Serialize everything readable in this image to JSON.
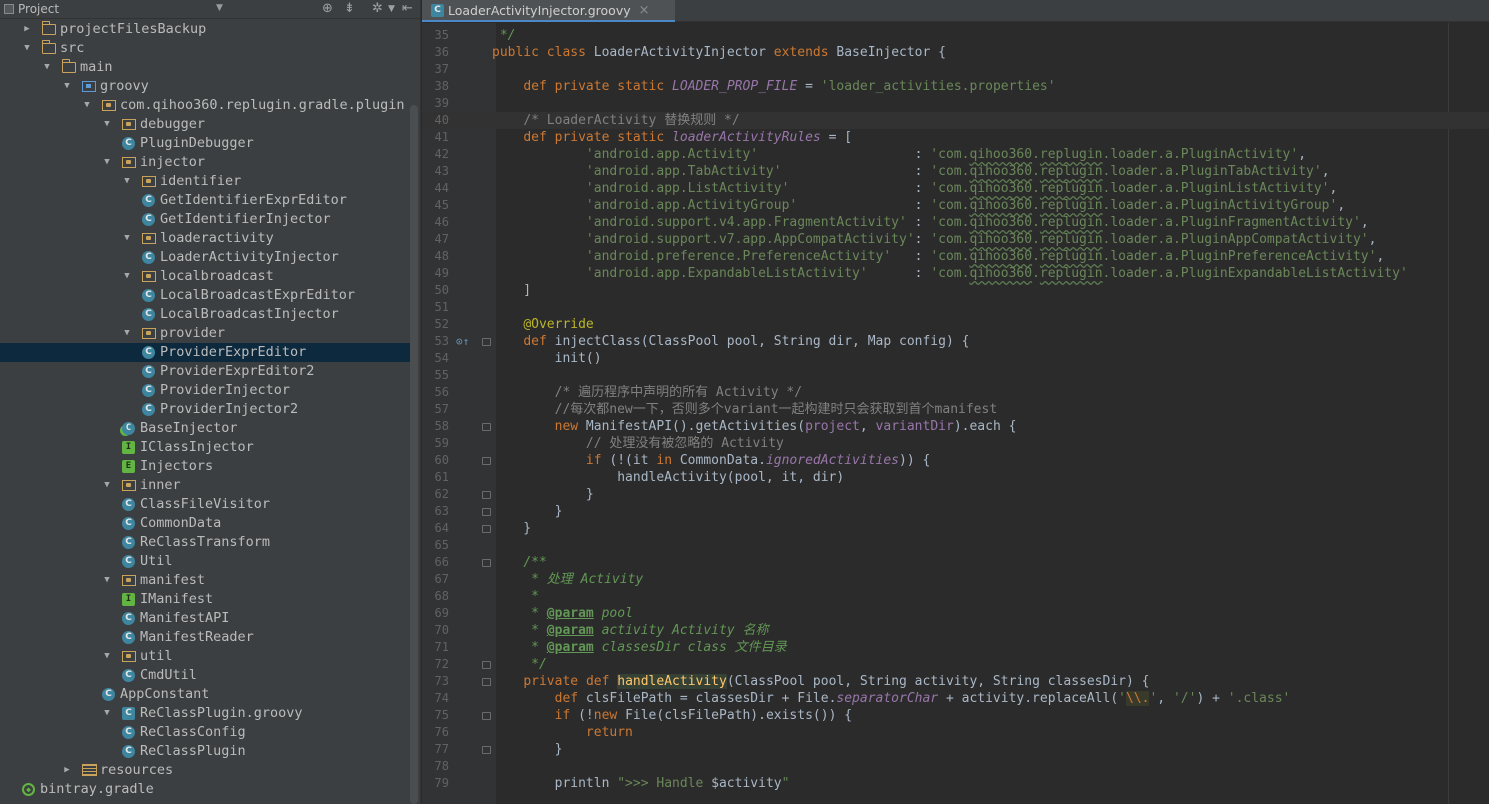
{
  "project_panel": {
    "title": "Project",
    "tree": [
      {
        "label": "projectFilesBackup",
        "icon": "folder-icon",
        "arrow": "▶",
        "depth": 0
      },
      {
        "label": "src",
        "icon": "folder-icon",
        "arrow": "▼",
        "depth": 0
      },
      {
        "label": "main",
        "icon": "folder-icon",
        "arrow": "▼",
        "depth": 1
      },
      {
        "label": "groovy",
        "icon": "source-folder-icon",
        "arrow": "▼",
        "depth": 2
      },
      {
        "label": "com.qihoo360.replugin.gradle.plugin",
        "icon": "package-icon",
        "arrow": "▼",
        "depth": 3
      },
      {
        "label": "debugger",
        "icon": "package-icon",
        "arrow": "▼",
        "depth": 4
      },
      {
        "label": "PluginDebugger",
        "icon": "class-icon",
        "arrow": "",
        "depth": 5
      },
      {
        "label": "injector",
        "icon": "package-icon",
        "arrow": "▼",
        "depth": 4
      },
      {
        "label": "identifier",
        "icon": "package-icon",
        "arrow": "▼",
        "depth": 5
      },
      {
        "label": "GetIdentifierExprEditor",
        "icon": "class-icon",
        "arrow": "",
        "depth": 6
      },
      {
        "label": "GetIdentifierInjector",
        "icon": "class-icon",
        "arrow": "",
        "depth": 6
      },
      {
        "label": "loaderactivity",
        "icon": "package-icon",
        "arrow": "▼",
        "depth": 5
      },
      {
        "label": "LoaderActivityInjector",
        "icon": "class-icon",
        "arrow": "",
        "depth": 6
      },
      {
        "label": "localbroadcast",
        "icon": "package-icon",
        "arrow": "▼",
        "depth": 5
      },
      {
        "label": "LocalBroadcastExprEditor",
        "icon": "class-icon",
        "arrow": "",
        "depth": 6
      },
      {
        "label": "LocalBroadcastInjector",
        "icon": "class-icon",
        "arrow": "",
        "depth": 6
      },
      {
        "label": "provider",
        "icon": "package-icon",
        "arrow": "▼",
        "depth": 5
      },
      {
        "label": "ProviderExprEditor",
        "icon": "class-icon",
        "arrow": "",
        "depth": 6,
        "selected": true
      },
      {
        "label": "ProviderExprEditor2",
        "icon": "class-icon",
        "arrow": "",
        "depth": 6
      },
      {
        "label": "ProviderInjector",
        "icon": "class-icon",
        "arrow": "",
        "depth": 6
      },
      {
        "label": "ProviderInjector2",
        "icon": "class-icon",
        "arrow": "",
        "depth": 6
      },
      {
        "label": "BaseInjector",
        "icon": "abstract-class-icon",
        "arrow": "",
        "depth": 5
      },
      {
        "label": "IClassInjector",
        "icon": "interface-icon",
        "arrow": "",
        "depth": 5
      },
      {
        "label": "Injectors",
        "icon": "enum-icon",
        "arrow": "",
        "depth": 5
      },
      {
        "label": "inner",
        "icon": "package-icon",
        "arrow": "▼",
        "depth": 4
      },
      {
        "label": "ClassFileVisitor",
        "icon": "class-icon",
        "arrow": "",
        "depth": 5
      },
      {
        "label": "CommonData",
        "icon": "class-icon",
        "arrow": "",
        "depth": 5
      },
      {
        "label": "ReClassTransform",
        "icon": "class-icon",
        "arrow": "",
        "depth": 5
      },
      {
        "label": "Util",
        "icon": "class-icon",
        "arrow": "",
        "depth": 5
      },
      {
        "label": "manifest",
        "icon": "package-icon",
        "arrow": "▼",
        "depth": 4
      },
      {
        "label": "IManifest",
        "icon": "interface-icon",
        "arrow": "",
        "depth": 5
      },
      {
        "label": "ManifestAPI",
        "icon": "class-icon",
        "arrow": "",
        "depth": 5
      },
      {
        "label": "ManifestReader",
        "icon": "class-icon",
        "arrow": "",
        "depth": 5
      },
      {
        "label": "util",
        "icon": "package-icon",
        "arrow": "▼",
        "depth": 4
      },
      {
        "label": "CmdUtil",
        "icon": "class-icon",
        "arrow": "",
        "depth": 5
      },
      {
        "label": "AppConstant",
        "icon": "class-icon",
        "arrow": "",
        "depth": 4
      },
      {
        "label": "ReClassPlugin.groovy",
        "icon": "groovy-file-icon",
        "arrow": "▼",
        "depth": 4
      },
      {
        "label": "ReClassConfig",
        "icon": "class-icon",
        "arrow": "",
        "depth": 5
      },
      {
        "label": "ReClassPlugin",
        "icon": "class-icon",
        "arrow": "",
        "depth": 5
      },
      {
        "label": "resources",
        "icon": "resources-folder-icon",
        "arrow": "▶",
        "depth": 2
      },
      {
        "label": "bintray.gradle",
        "icon": "gradle-icon",
        "arrow": "",
        "depth": 0
      }
    ]
  },
  "editor": {
    "tab_label": "LoaderActivityInjector.groovy",
    "tab_close": "×",
    "code_lines": [
      {
        "n": "35",
        "t": [
          [
            " */",
            "d"
          ]
        ]
      },
      {
        "n": "36",
        "t": [
          [
            "public",
            "k"
          ],
          [
            " "
          ],
          [
            "class",
            "k"
          ],
          [
            " LoaderActivityInjector "
          ],
          [
            "extends",
            "k"
          ],
          [
            " BaseInjector {"
          ]
        ]
      },
      {
        "n": "37",
        "t": []
      },
      {
        "n": "38",
        "t": [
          [
            "    "
          ],
          [
            "def",
            "k"
          ],
          [
            " "
          ],
          [
            "private",
            "k"
          ],
          [
            " "
          ],
          [
            "static",
            "k"
          ],
          [
            " "
          ],
          [
            "LOADER_PROP_FILE",
            "f"
          ],
          [
            " = "
          ],
          [
            "'loader_activities.properties'",
            "s"
          ]
        ]
      },
      {
        "n": "39",
        "t": []
      },
      {
        "n": "40",
        "t": [
          [
            "    "
          ],
          [
            "/* LoaderActivity 替换规则 */",
            "c"
          ]
        ],
        "caret": true
      },
      {
        "n": "41",
        "t": [
          [
            "    "
          ],
          [
            "def",
            "k"
          ],
          [
            " "
          ],
          [
            "private",
            "k"
          ],
          [
            " "
          ],
          [
            "static",
            "k"
          ],
          [
            " "
          ],
          [
            "loaderActivityRules",
            "f"
          ],
          [
            " = ["
          ]
        ]
      },
      {
        "n": "42",
        "t": [
          [
            "            "
          ],
          [
            "'android.app.Activity'",
            "s"
          ],
          [
            "                    : "
          ],
          [
            "'com.",
            "s"
          ],
          [
            "qihoo360",
            "su"
          ],
          [
            ".",
            "s"
          ],
          [
            "replugin",
            "su"
          ],
          [
            ".loader.a.PluginActivity'",
            "s"
          ],
          [
            ","
          ]
        ]
      },
      {
        "n": "43",
        "t": [
          [
            "            "
          ],
          [
            "'android.app.TabActivity'",
            "s"
          ],
          [
            "                 : "
          ],
          [
            "'com.",
            "s"
          ],
          [
            "qihoo360",
            "su"
          ],
          [
            ".",
            "s"
          ],
          [
            "replugin",
            "su"
          ],
          [
            ".loader.a.PluginTabActivity'",
            "s"
          ],
          [
            ","
          ]
        ]
      },
      {
        "n": "44",
        "t": [
          [
            "            "
          ],
          [
            "'android.app.ListActivity'",
            "s"
          ],
          [
            "                : "
          ],
          [
            "'com.",
            "s"
          ],
          [
            "qihoo360",
            "su"
          ],
          [
            ".",
            "s"
          ],
          [
            "replugin",
            "su"
          ],
          [
            ".loader.a.PluginListActivity'",
            "s"
          ],
          [
            ","
          ]
        ]
      },
      {
        "n": "45",
        "t": [
          [
            "            "
          ],
          [
            "'android.app.ActivityGroup'",
            "s"
          ],
          [
            "               : "
          ],
          [
            "'com.",
            "s"
          ],
          [
            "qihoo360",
            "su"
          ],
          [
            ".",
            "s"
          ],
          [
            "replugin",
            "su"
          ],
          [
            ".loader.a.PluginActivityGroup'",
            "s"
          ],
          [
            ","
          ]
        ]
      },
      {
        "n": "46",
        "t": [
          [
            "            "
          ],
          [
            "'android.support.v4.app.FragmentActivity'",
            "s"
          ],
          [
            " : "
          ],
          [
            "'com.",
            "s"
          ],
          [
            "qihoo360",
            "su"
          ],
          [
            ".",
            "s"
          ],
          [
            "replugin",
            "su"
          ],
          [
            ".loader.a.PluginFragmentActivity'",
            "s"
          ],
          [
            ","
          ]
        ]
      },
      {
        "n": "47",
        "t": [
          [
            "            "
          ],
          [
            "'android.support.v7.app.AppCompatActivity'",
            "s"
          ],
          [
            ": "
          ],
          [
            "'com.",
            "s"
          ],
          [
            "qihoo360",
            "su"
          ],
          [
            ".",
            "s"
          ],
          [
            "replugin",
            "su"
          ],
          [
            ".loader.a.PluginAppCompatActivity'",
            "s"
          ],
          [
            ","
          ]
        ]
      },
      {
        "n": "48",
        "t": [
          [
            "            "
          ],
          [
            "'android.preference.PreferenceActivity'",
            "s"
          ],
          [
            "   : "
          ],
          [
            "'com.",
            "s"
          ],
          [
            "qihoo360",
            "su"
          ],
          [
            ".",
            "s"
          ],
          [
            "replugin",
            "su"
          ],
          [
            ".loader.a.PluginPreferenceActivity'",
            "s"
          ],
          [
            ","
          ]
        ]
      },
      {
        "n": "49",
        "t": [
          [
            "            "
          ],
          [
            "'android.app.ExpandableListActivity'",
            "s"
          ],
          [
            "      : "
          ],
          [
            "'com.",
            "s"
          ],
          [
            "qihoo360",
            "su"
          ],
          [
            ".",
            "s"
          ],
          [
            "replugin",
            "su"
          ],
          [
            ".loader.a.PluginExpandableListActivity'",
            "s"
          ]
        ]
      },
      {
        "n": "50",
        "t": [
          [
            "    ]"
          ]
        ]
      },
      {
        "n": "51",
        "t": []
      },
      {
        "n": "52",
        "t": [
          [
            "    "
          ],
          [
            "@Override",
            "a"
          ]
        ]
      },
      {
        "n": "53",
        "t": [
          [
            "    "
          ],
          [
            "def",
            "k"
          ],
          [
            " injectClass(ClassPool pool, String dir, Map config) {"
          ]
        ],
        "marker": "⊙↑",
        "fold": true
      },
      {
        "n": "54",
        "t": [
          [
            "        init()"
          ]
        ]
      },
      {
        "n": "55",
        "t": []
      },
      {
        "n": "56",
        "t": [
          [
            "        "
          ],
          [
            "/* 遍历程序中声明的所有 Activity */",
            "c"
          ]
        ]
      },
      {
        "n": "57",
        "t": [
          [
            "        "
          ],
          [
            "//每次都new一下，否则多个variant一起构建时只会获取到首个manifest",
            "c"
          ]
        ]
      },
      {
        "n": "58",
        "t": [
          [
            "        "
          ],
          [
            "new",
            "k"
          ],
          [
            " ManifestAPI().getActivities("
          ],
          [
            "project",
            "p"
          ],
          [
            ", "
          ],
          [
            "variantDir",
            "p"
          ],
          [
            ").each {"
          ]
        ],
        "fold": true
      },
      {
        "n": "59",
        "t": [
          [
            "            "
          ],
          [
            "// 处理没有被忽略的 Activity",
            "c"
          ]
        ]
      },
      {
        "n": "60",
        "t": [
          [
            "            "
          ],
          [
            "if",
            "k"
          ],
          [
            " (!(it "
          ],
          [
            "in",
            "k"
          ],
          [
            " CommonData."
          ],
          [
            "ignoredActivities",
            "f"
          ],
          [
            ")) {"
          ]
        ],
        "fold": true
      },
      {
        "n": "61",
        "t": [
          [
            "                handleActivity(pool, it, dir)"
          ]
        ]
      },
      {
        "n": "62",
        "t": [
          [
            "            }"
          ]
        ],
        "fold": true
      },
      {
        "n": "63",
        "t": [
          [
            "        }"
          ]
        ],
        "fold": true
      },
      {
        "n": "64",
        "t": [
          [
            "    }"
          ]
        ],
        "fold": true
      },
      {
        "n": "65",
        "t": []
      },
      {
        "n": "66",
        "t": [
          [
            "    "
          ],
          [
            "/**",
            "d"
          ]
        ],
        "fold": true
      },
      {
        "n": "67",
        "t": [
          [
            "     "
          ],
          [
            "* 处理 ",
            "d"
          ],
          [
            "Activity",
            "d"
          ]
        ]
      },
      {
        "n": "68",
        "t": [
          [
            "     "
          ],
          [
            "*",
            "d"
          ]
        ]
      },
      {
        "n": "69",
        "t": [
          [
            "     "
          ],
          [
            "* ",
            "d"
          ],
          [
            "@param",
            "dt"
          ],
          [
            " pool",
            "d"
          ]
        ]
      },
      {
        "n": "70",
        "t": [
          [
            "     "
          ],
          [
            "* ",
            "d"
          ],
          [
            "@param",
            "dt"
          ],
          [
            " activity Activity 名称",
            "d"
          ]
        ]
      },
      {
        "n": "71",
        "t": [
          [
            "     "
          ],
          [
            "* ",
            "d"
          ],
          [
            "@param",
            "dt"
          ],
          [
            " classesDir class 文件目录",
            "d"
          ]
        ]
      },
      {
        "n": "72",
        "t": [
          [
            "     "
          ],
          [
            "*/",
            "d"
          ]
        ],
        "fold": true
      },
      {
        "n": "73",
        "t": [
          [
            "    "
          ],
          [
            "private",
            "k"
          ],
          [
            " "
          ],
          [
            "def",
            "k"
          ],
          [
            " "
          ],
          [
            "handleActivity",
            "mh"
          ],
          [
            "(ClassPool pool, String activity, String classesDir) {"
          ]
        ],
        "fold": true
      },
      {
        "n": "74",
        "t": [
          [
            "        "
          ],
          [
            "def",
            "k"
          ],
          [
            " clsFilePath = classesDir + File."
          ],
          [
            "separatorChar",
            "f"
          ],
          [
            " + activity.replaceAll("
          ],
          [
            "'",
            "s"
          ],
          [
            "\\\\.",
            "e"
          ],
          [
            "'",
            "s"
          ],
          [
            ", "
          ],
          [
            "'/'",
            "s"
          ],
          [
            ") + "
          ],
          [
            "'.class'",
            "s"
          ]
        ]
      },
      {
        "n": "75",
        "t": [
          [
            "        "
          ],
          [
            "if",
            "k"
          ],
          [
            " (!"
          ],
          [
            "new",
            "k"
          ],
          [
            " File(clsFilePath).exists()) {"
          ]
        ],
        "fold": true
      },
      {
        "n": "76",
        "t": [
          [
            "            "
          ],
          [
            "return",
            "k"
          ]
        ]
      },
      {
        "n": "77",
        "t": [
          [
            "        }"
          ]
        ],
        "fold": true
      },
      {
        "n": "78",
        "t": []
      },
      {
        "n": "79",
        "t": [
          [
            "        println "
          ],
          [
            "\">>> Handle ",
            "s"
          ],
          [
            "$activity",
            "hv"
          ],
          [
            "\"",
            "s"
          ]
        ]
      }
    ]
  },
  "colors": {
    "keyword": "#cc7832",
    "string": "#6a8759",
    "comment": "#808080",
    "field": "#9876aa",
    "annotation": "#bbb529",
    "doc": "#629755",
    "method": "#ffc66d"
  }
}
